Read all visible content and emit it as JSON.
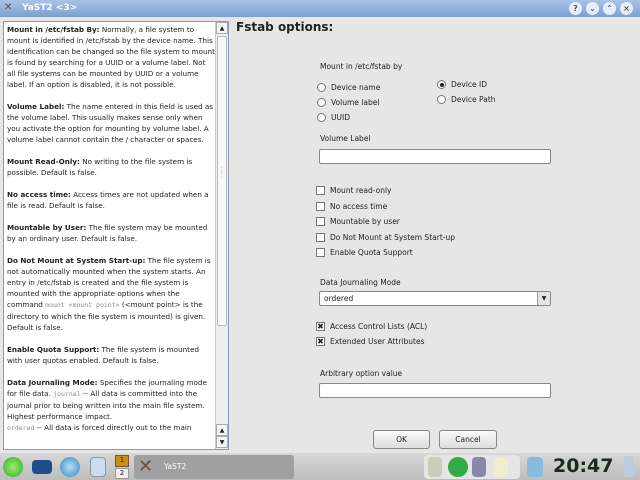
{
  "window": {
    "title": "YaST2 <3>",
    "help_btn": "?",
    "close_btn": "×"
  },
  "help": {
    "paragraphs": [
      {
        "title": "Mount in /etc/fstab By:",
        "text": " Normally, a file system to mount is identified in /etc/fstab by the device name. This identification can be changed so the file system to mount is found by searching for a UUID or a volume label. Not all file systems can be mounted by UUID or a volume label. If an option is disabled, it is not possible."
      },
      {
        "title": "Volume Label:",
        "text": " The name entered in this field is used as the volume label. This usually makes sense only when you activate the option for mounting by volume label. A volume label cannot contain the / character or spaces."
      },
      {
        "title": "Mount Read-Only:",
        "text": " No writing to the file system is possible. Default is false."
      },
      {
        "title": "No access time:",
        "text": " Access times are not updated when a file is read. Default is false."
      },
      {
        "title": "Mountable by User:",
        "text": " The file system may be mounted by an ordinary user. Default is false."
      },
      {
        "title": "Do Not Mount at System Start-up:",
        "text": " The file system is not automatically mounted when the system starts. An entry in /etc/fstab is created and the file system is mounted with the appropriate options when the command ",
        "code": "mount <mount point>",
        "text2": " (<mount point> is the directory to which the file system is mounted) is given. Default is false."
      },
      {
        "title": "Enable Quota Support:",
        "text": " The file system is mounted with user quotas enabled. Default is false."
      },
      {
        "title": "Data Journaling Mode:",
        "text": " Specifies the journaling mode for file data. ",
        "code": "journal",
        "text2": " -- All data is committed into the journal prior to being written into the main file system. Highest performance impact."
      }
    ],
    "last_code": "ordered",
    "last_text": " -- All data is forced directly out to the main"
  },
  "form": {
    "title": "Fstab options:",
    "mount_by_label": "Mount in /etc/fstab by",
    "radios": [
      {
        "label": "Device name",
        "checked": false
      },
      {
        "label": "Volume label",
        "checked": false
      },
      {
        "label": "UUID",
        "checked": false
      },
      {
        "label": "Device ID",
        "checked": true
      },
      {
        "label": "Device Path",
        "checked": false
      }
    ],
    "volume_label": "Volume Label",
    "volume_value": "",
    "checks": [
      {
        "label": "Mount read-only",
        "checked": false
      },
      {
        "label": "No access time",
        "checked": false
      },
      {
        "label": "Mountable by user",
        "checked": false
      },
      {
        "label": "Do Not Mount at System Start-up",
        "checked": false
      },
      {
        "label": "Enable Quota Support",
        "checked": false
      }
    ],
    "journal_label": "Data Journaling Mode",
    "journal_value": "ordered",
    "checks2": [
      {
        "label": "Access Control Lists (ACL)",
        "checked": true
      },
      {
        "label": "Extended User Attributes",
        "checked": true
      }
    ],
    "arb_label": "Arbitrary option value",
    "arb_value": "",
    "ok": "OK",
    "cancel": "Cancel"
  },
  "taskbar": {
    "desk1": "1",
    "desk2": "2",
    "task": "YaST2",
    "clock": "20:47"
  }
}
